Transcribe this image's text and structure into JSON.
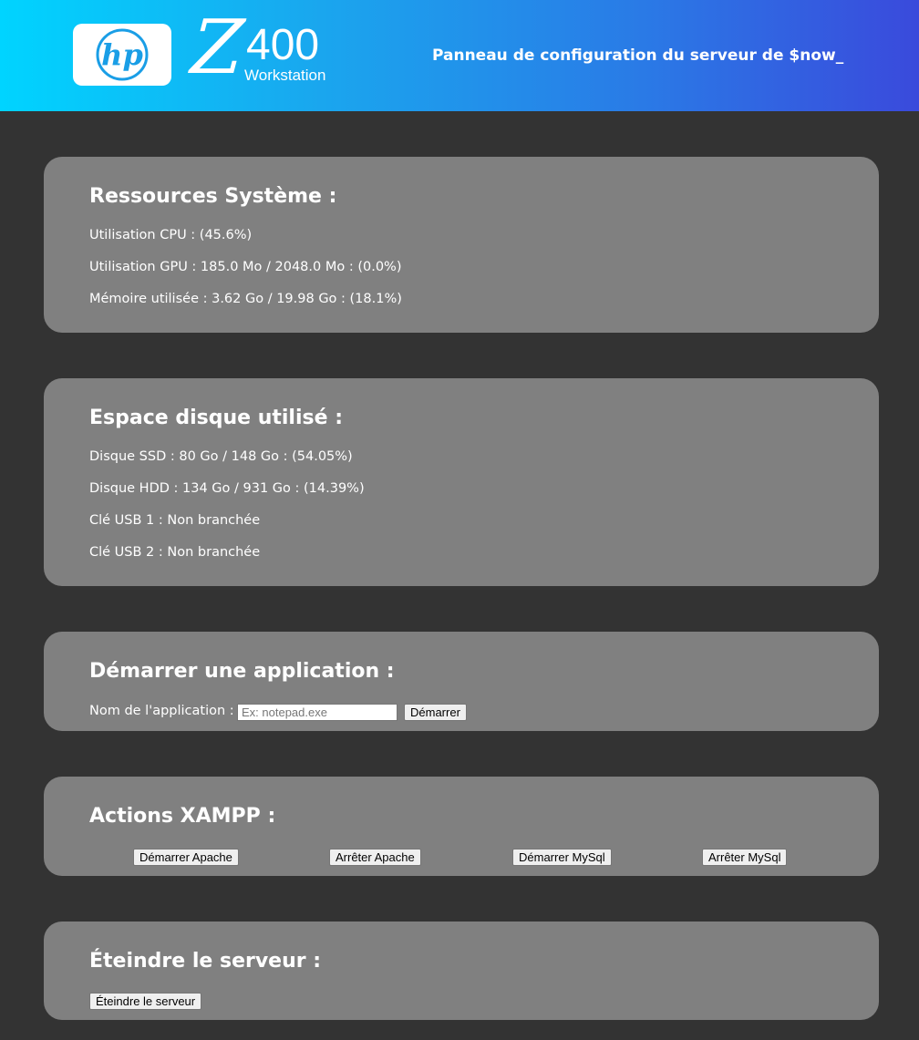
{
  "header": {
    "logo_text": "hp",
    "brand_letter": "Z",
    "brand_model": "400",
    "brand_sub": "Workstation",
    "title": "Panneau de configuration du serveur de $now_"
  },
  "resources": {
    "title": "Ressources Système :",
    "cpu": "Utilisation CPU : (45.6%)",
    "gpu": "Utilisation GPU : 185.0 Mo / 2048.0 Mo : (0.0%)",
    "memory": "Mémoire utilisée : 3.62 Go / 19.98 Go : (18.1%)"
  },
  "disk": {
    "title": "Espace disque utilisé :",
    "ssd": "Disque SSD : 80 Go / 148 Go : (54.05%)",
    "hdd": "Disque HDD : 134 Go / 931 Go : (14.39%)",
    "usb1": "Clé USB 1 : Non branchée",
    "usb2": "Clé USB 2 : Non branchée"
  },
  "launch": {
    "title": "Démarrer une application :",
    "label": "Nom de l'application :",
    "placeholder": "Ex: notepad.exe",
    "value": "",
    "button": "Démarrer"
  },
  "xampp": {
    "title": "Actions XAMPP :",
    "start_apache": "Démarrer Apache",
    "stop_apache": "Arrêter Apache",
    "start_mysql": "Démarrer MySql",
    "stop_mysql": "Arrêter MySql"
  },
  "shutdown": {
    "title": "Éteindre le serveur :",
    "button": "Éteindre le serveur"
  },
  "colors": {
    "background": "#333333",
    "card": "#808080",
    "header_gradient_start": "#00d4ff",
    "header_gradient_end": "#3a4adc"
  }
}
